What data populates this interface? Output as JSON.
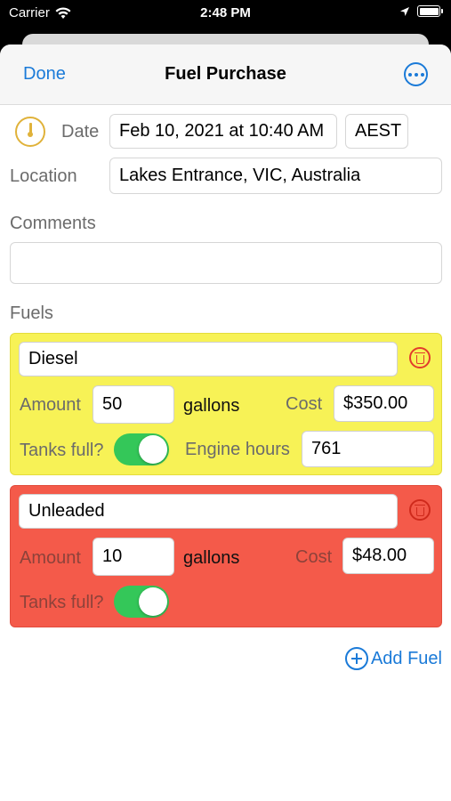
{
  "status_bar": {
    "carrier": "Carrier",
    "time": "2:48 PM"
  },
  "nav": {
    "done_label": "Done",
    "title": "Fuel Purchase"
  },
  "form": {
    "date_label": "Date",
    "date_value": "Feb 10, 2021 at 10:40 AM",
    "timezone_value": "AEST",
    "location_label": "Location",
    "location_value": "Lakes Entrance, VIC, Australia",
    "comments_label": "Comments",
    "comments_value": "",
    "fuels_label": "Fuels"
  },
  "fuels": [
    {
      "name": "Diesel",
      "amount_label": "Amount",
      "amount_value": "50",
      "unit": "gallons",
      "cost_label": "Cost",
      "cost_value": "$350.00",
      "tanks_full_label": "Tanks full?",
      "tanks_full": true,
      "engine_hours_label": "Engine hours",
      "engine_hours_value": "761",
      "color": "#f7f256"
    },
    {
      "name": "Unleaded",
      "amount_label": "Amount",
      "amount_value": "10",
      "unit": "gallons",
      "cost_label": "Cost",
      "cost_value": "$48.00",
      "tanks_full_label": "Tanks full?",
      "tanks_full": true,
      "color": "#f45a4a"
    }
  ],
  "add_fuel_label": "Add Fuel",
  "colors": {
    "accent": "#1a7ad8",
    "toggle_on": "#34c759"
  },
  "icons": {
    "gauge": "fuel-gauge-icon",
    "more": "ellipsis-circle-icon",
    "trash": "trash-icon",
    "add": "plus-circle-icon"
  }
}
